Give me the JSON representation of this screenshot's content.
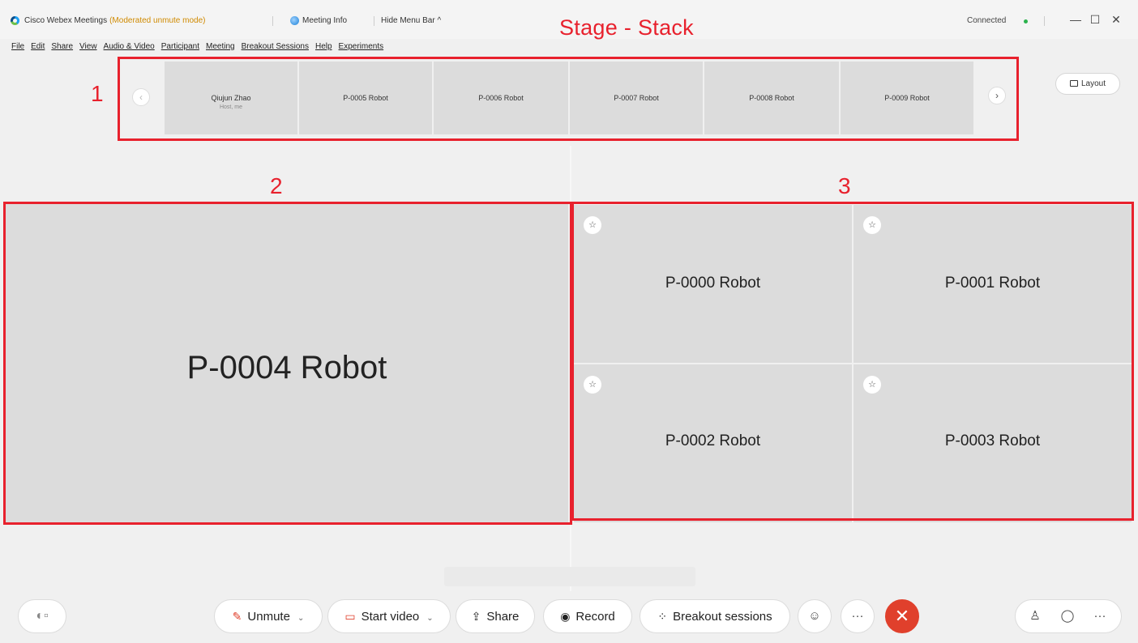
{
  "titlebar": {
    "app_name": "Cisco Webex Meetings",
    "mode": "(Moderated unmute mode)",
    "meeting_info": "Meeting Info",
    "hide_menu_bar": "Hide Menu Bar ^",
    "connection_status": "Connected",
    "minimize": "—",
    "maximize": "☐",
    "close": "✕"
  },
  "menubar": {
    "items": [
      "File",
      "Edit",
      "Share",
      "View",
      "Audio & Video",
      "Participant",
      "Meeting",
      "Breakout Sessions",
      "Help",
      "Experiments"
    ]
  },
  "annotation": {
    "title": "Stage - Stack",
    "label_1": "1",
    "label_2": "2",
    "label_3": "3",
    "accent_color": "#e8212d"
  },
  "filmstrip": {
    "prev": "‹",
    "next": "›",
    "tiles": [
      {
        "name": "Qiujun Zhao",
        "sub": "Host, me"
      },
      {
        "name": "P-0005 Robot",
        "sub": ""
      },
      {
        "name": "P-0006 Robot",
        "sub": ""
      },
      {
        "name": "P-0007 Robot",
        "sub": ""
      },
      {
        "name": "P-0008 Robot",
        "sub": ""
      },
      {
        "name": "P-0009 Robot",
        "sub": ""
      }
    ]
  },
  "layout_button": "Layout",
  "stage": {
    "main_name": "P-0004 Robot",
    "grid": [
      {
        "name": "P-0000 Robot"
      },
      {
        "name": "P-0001 Robot"
      },
      {
        "name": "P-0002 Robot"
      },
      {
        "name": "P-0003 Robot"
      }
    ],
    "pin_icon": "☆"
  },
  "controls": {
    "unmute": "Unmute",
    "start_video": "Start video",
    "share": "Share",
    "record": "Record",
    "breakout": "Breakout sessions",
    "reactions_icon": "☺",
    "more": "···",
    "end": "✕",
    "participants_icon": "♙",
    "chat_icon": "◯",
    "right_more": "···",
    "end_color": "#e0402c"
  }
}
